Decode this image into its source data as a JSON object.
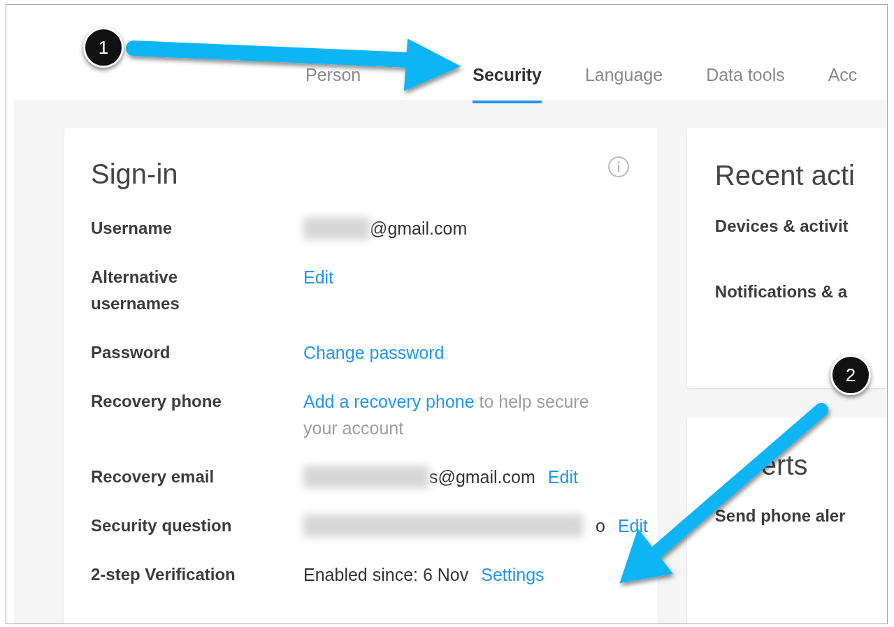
{
  "tabs": [
    {
      "label": "Person",
      "selected": false
    },
    {
      "label": "Security",
      "selected": true
    },
    {
      "label": "Language",
      "selected": false
    },
    {
      "label": "Data tools",
      "selected": false
    },
    {
      "label": "Acc",
      "selected": false
    }
  ],
  "signin": {
    "title": "Sign-in",
    "rows": [
      {
        "label": "Username",
        "parts": [
          {
            "kind": "blur"
          },
          {
            "kind": "text",
            "text": "@gmail.com"
          }
        ]
      },
      {
        "label": "Alternative usernames",
        "parts": [
          {
            "kind": "link",
            "text": "Edit"
          }
        ]
      },
      {
        "label": "Password",
        "parts": [
          {
            "kind": "link",
            "text": "Change password"
          }
        ]
      },
      {
        "label": "Recovery phone",
        "parts": [
          {
            "kind": "sentence",
            "link": "Add a recovery phone",
            "text": " to help secure your account"
          }
        ]
      },
      {
        "label": "Recovery email",
        "parts": [
          {
            "kind": "blur"
          },
          {
            "kind": "text",
            "text": "s@gmail.com"
          },
          {
            "kind": "link",
            "text": "Edit"
          }
        ]
      },
      {
        "label": "Security question",
        "parts": [
          {
            "kind": "blur"
          },
          {
            "kind": "text",
            "text": "o"
          },
          {
            "kind": "link",
            "text": "Edit"
          }
        ]
      },
      {
        "label": "2-step Verification",
        "parts": [
          {
            "kind": "text",
            "text": "Enabled since: 6 Nov"
          },
          {
            "kind": "link",
            "text": "Settings"
          }
        ]
      }
    ]
  },
  "recent": {
    "title": "Recent acti",
    "items": [
      "Devices & activit",
      "Notifications & a"
    ]
  },
  "alerts": {
    "title": "erts",
    "items": [
      "Send phone aler"
    ]
  },
  "annotations": [
    {
      "number": "1"
    },
    {
      "number": "2"
    }
  ]
}
